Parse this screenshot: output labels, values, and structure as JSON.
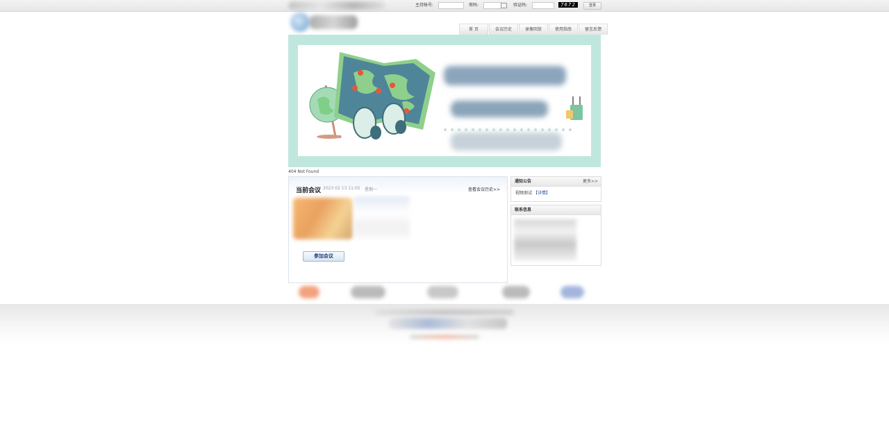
{
  "topbar": {
    "host_label": "主持帐号:",
    "password_label": "密码:",
    "captcha_label": "验证码:",
    "captcha_value": "7672",
    "login_button": "登录"
  },
  "nav": {
    "items": [
      "首 页",
      "会议历史",
      "录像回放",
      "使用指南",
      "留言反馈"
    ]
  },
  "error_text": "404 Not Found",
  "current_meeting": {
    "title": "当前会议",
    "datetime": "2023 02 13 11:05",
    "weekday": "星期一",
    "history_link": "查看会议历史>>",
    "join_button": "参加会议"
  },
  "notice": {
    "title": "通知公告",
    "more": "更多>>",
    "item_text": "视频测试",
    "item_detail": "【详情】"
  },
  "contact": {
    "title": "联系信息"
  },
  "colors": {
    "banner_bg": "#c0e7dd",
    "map_blue": "#4f8599",
    "map_green": "#8ed08b",
    "pin": "#e4583d",
    "link_blue": "#1f4b9b"
  },
  "icons": [
    "calendar-icon",
    "globe-icon",
    "binoculars-icon",
    "map-icon",
    "suitcase-icon",
    "map-pin-icon"
  ]
}
